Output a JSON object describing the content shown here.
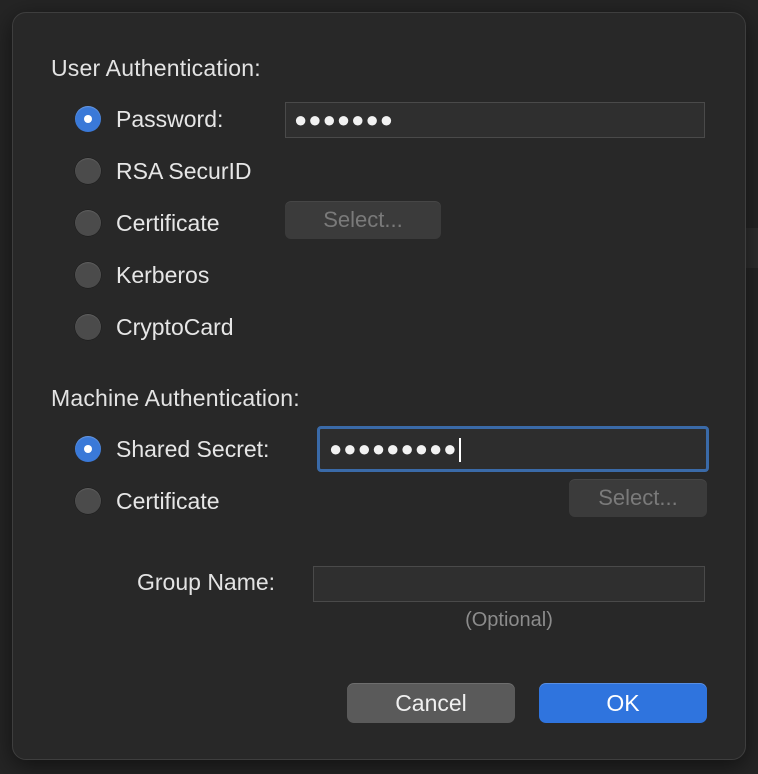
{
  "user_auth": {
    "title": "User Authentication:",
    "options": [
      {
        "label": "Password:",
        "selected": true
      },
      {
        "label": "RSA SecurID",
        "selected": false
      },
      {
        "label": "Certificate",
        "selected": false
      },
      {
        "label": "Kerberos",
        "selected": false
      },
      {
        "label": "CryptoCard",
        "selected": false
      }
    ],
    "password_value": "●●●●●●●",
    "select_label": "Select..."
  },
  "machine_auth": {
    "title": "Machine Authentication:",
    "options": [
      {
        "label": "Shared Secret:",
        "selected": true
      },
      {
        "label": "Certificate",
        "selected": false
      }
    ],
    "shared_secret_value": "●●●●●●●●●",
    "select_label": "Select..."
  },
  "group": {
    "label": "Group Name:",
    "value": "",
    "hint": "(Optional)"
  },
  "buttons": {
    "cancel": "Cancel",
    "ok": "OK"
  },
  "colors": {
    "accent": "#2f74de",
    "radio_selected": "#3a79d8",
    "focus_ring": "#3a6aa8",
    "sheet_background": "#282828"
  }
}
